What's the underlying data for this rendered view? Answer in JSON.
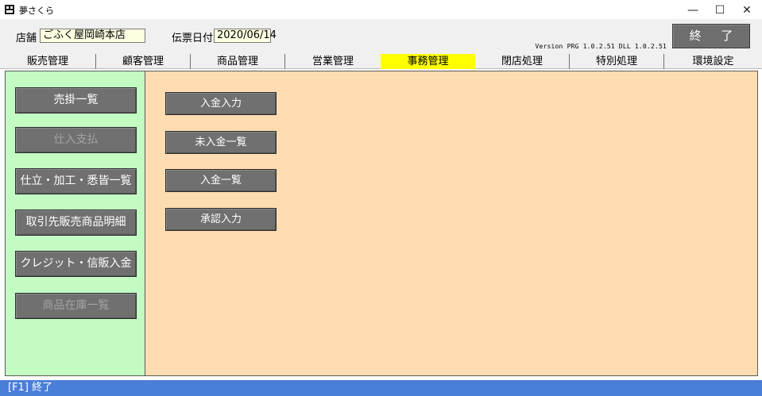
{
  "window": {
    "title": "夢さくら",
    "minimize_glyph": "—",
    "maximize_glyph": "☐",
    "close_glyph": "✕"
  },
  "header": {
    "store_label": "店舗",
    "store_value": "ごふく屋岡崎本店",
    "date_label": "伝票日付",
    "date_value": "2020/06/14",
    "version_text": "Version PRG 1.0.2.51 DLL 1.0.2.51",
    "exit_label": "終 了"
  },
  "tabs": [
    {
      "label": "販売管理"
    },
    {
      "label": "顧客管理"
    },
    {
      "label": "商品管理"
    },
    {
      "label": "営業管理"
    },
    {
      "label": "事務管理"
    },
    {
      "label": "閉店処理"
    },
    {
      "label": "特別処理"
    },
    {
      "label": "環境設定"
    }
  ],
  "active_tab": "事務管理",
  "left_menu": [
    {
      "label": "売掛一覧",
      "enabled": true
    },
    {
      "label": "仕入支払",
      "enabled": false
    },
    {
      "label": "仕立・加工・悉皆一覧",
      "enabled": true
    },
    {
      "label": "取引先販売商品明細",
      "enabled": true
    },
    {
      "label": "クレジット・信販入金",
      "enabled": true
    },
    {
      "label": "商品在庫一覧",
      "enabled": false
    }
  ],
  "right_menu": [
    {
      "label": "入金入力"
    },
    {
      "label": "未入金一覧"
    },
    {
      "label": "入金一覧"
    },
    {
      "label": "承認入力"
    }
  ],
  "status": {
    "text": "[F1] 終了"
  },
  "colors": {
    "active_tab": "#ffff00",
    "left_panel": "#c3fcc3",
    "content_bg": "#fcdcb0",
    "button_bg": "#707070",
    "status_bar": "#4a7fd8"
  }
}
